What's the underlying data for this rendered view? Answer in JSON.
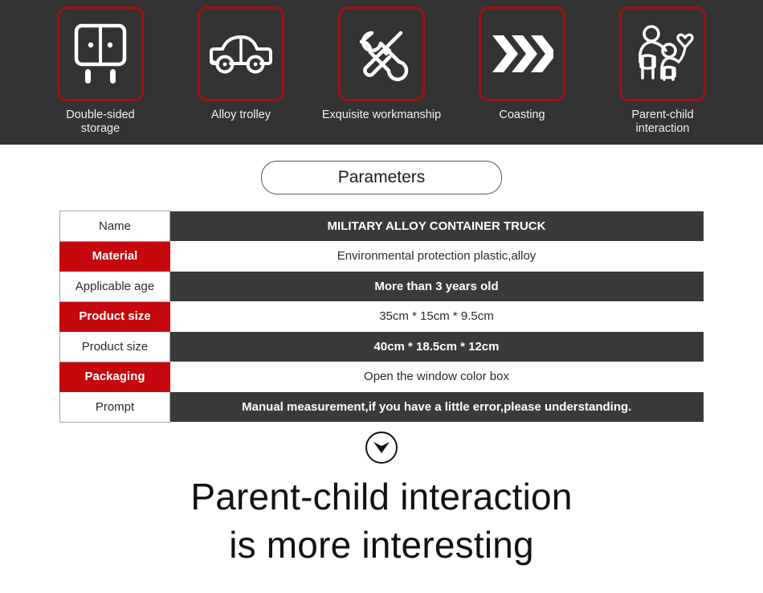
{
  "theme": {
    "dark_bg": "#333333",
    "accent_red": "#a01015",
    "cell_red": "#c4080e",
    "cell_dark": "#3a3a3a",
    "text_light": "#f2f2f2",
    "text_dark": "#1a1a1a"
  },
  "features": {
    "items": [
      {
        "icon": "double-door-cabinet-icon",
        "label": "Double-sided\nstorage",
        "label_line1": "Double-sided",
        "label_line2": "storage"
      },
      {
        "icon": "car-icon",
        "label": "Alloy trolley",
        "label_line1": "Alloy trolley",
        "label_line2": ""
      },
      {
        "icon": "wrench-screwdriver-icon",
        "label": "Exquisite workmanship",
        "label_line1": "Exquisite workmanship",
        "label_line2": ""
      },
      {
        "icon": "triple-chevron-right-icon",
        "label": "Coasting",
        "label_line1": "Coasting",
        "label_line2": ""
      },
      {
        "icon": "parent-child-balloon-icon",
        "label": "Parent-child\ninteraction",
        "label_line1": "Parent-child",
        "label_line2": "interaction"
      }
    ]
  },
  "parameters_button": {
    "label": "Parameters"
  },
  "spec_table": {
    "rows": [
      {
        "key": "Name",
        "value": "MILITARY ALLOY CONTAINER TRUCK",
        "key_style": "light",
        "value_style": "dark"
      },
      {
        "key": "Material",
        "value": "Environmental protection plastic,alloy",
        "key_style": "red",
        "value_style": "light"
      },
      {
        "key": "Applicable age",
        "value": "More than 3 years old",
        "key_style": "light",
        "value_style": "dark"
      },
      {
        "key": "Product size",
        "value": "35cm * 15cm * 9.5cm",
        "key_style": "red",
        "value_style": "light"
      },
      {
        "key": "Product size",
        "value": "40cm * 18.5cm * 12cm",
        "key_style": "light",
        "value_style": "dark"
      },
      {
        "key": "Packaging",
        "value": "Open the window color box",
        "key_style": "red",
        "value_style": "light"
      },
      {
        "key": "Prompt",
        "value": "Manual measurement,if you have a little error,please understanding.",
        "key_style": "light",
        "value_style": "dark"
      }
    ]
  },
  "scroll_hint": {
    "icon": "chevron-down-circle-icon"
  },
  "headline": {
    "line1": "Parent-child interaction",
    "line2": "is more interesting"
  }
}
